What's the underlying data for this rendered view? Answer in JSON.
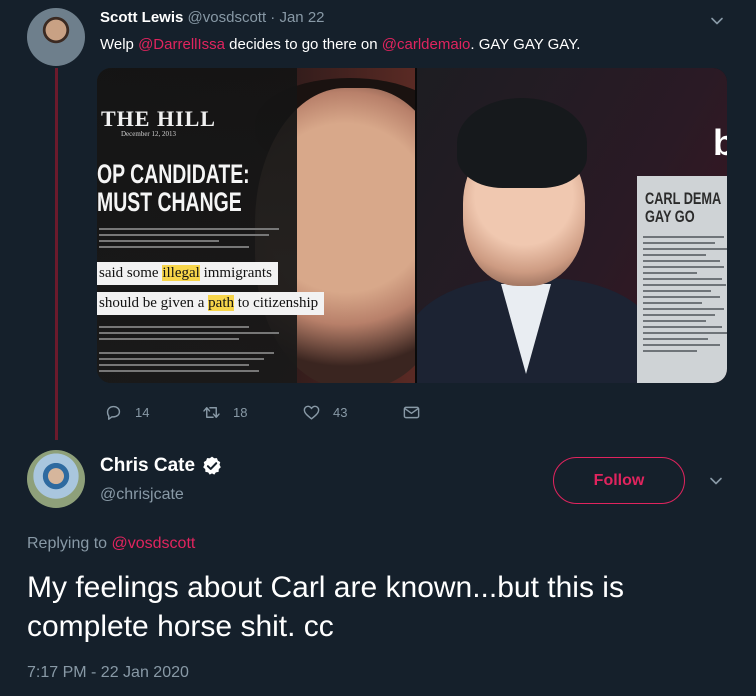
{
  "tweet1": {
    "author_name": "Scott Lewis",
    "author_handle": "@vosdscott",
    "separator": "·",
    "date": "Jan 22",
    "text_before": "Welp ",
    "mention1": "@DarrellIssa",
    "text_mid": " decides to go there on ",
    "mention2": "@carldemaio",
    "text_after": ". GAY GAY GAY.",
    "media": {
      "left": {
        "masthead": "THE HILL",
        "date": "December 12, 2013",
        "headline_line1": "OP CANDIDATE:",
        "headline_line2": "MUST CHANGE",
        "quote_line1_a": "said some ",
        "quote_line1_hl": "illegal",
        "quote_line1_b": " immigrants",
        "quote_line2_a": "should be given a ",
        "quote_line2_hl": "path",
        "quote_line2_b": " to citizenship"
      },
      "right": {
        "logo": "b",
        "sign_line1": "CARL DEMA",
        "sign_line2": "GAY GO"
      }
    },
    "actions": {
      "replies": "14",
      "retweets": "18",
      "likes": "43"
    }
  },
  "tweet2": {
    "author_name": "Chris Cate",
    "author_handle": "@chrisjcate",
    "follow_label": "Follow",
    "replying_prefix": "Replying to ",
    "replying_to": "@vosdscott",
    "text": "My feelings about Carl are known...but this is complete horse shit. cc",
    "timestamp": "7:17 PM - 22 Jan 2020"
  },
  "colors": {
    "background": "#15202b",
    "accent": "#e0245e",
    "muted": "#8899a6",
    "thread_line": "#6b1a2c",
    "verified": "#ffffff"
  },
  "icons": {
    "caret": "chevron-down-icon",
    "reply": "reply-icon",
    "retweet": "retweet-icon",
    "like": "heart-icon",
    "dm": "envelope-icon",
    "verified": "verified-badge-icon"
  }
}
